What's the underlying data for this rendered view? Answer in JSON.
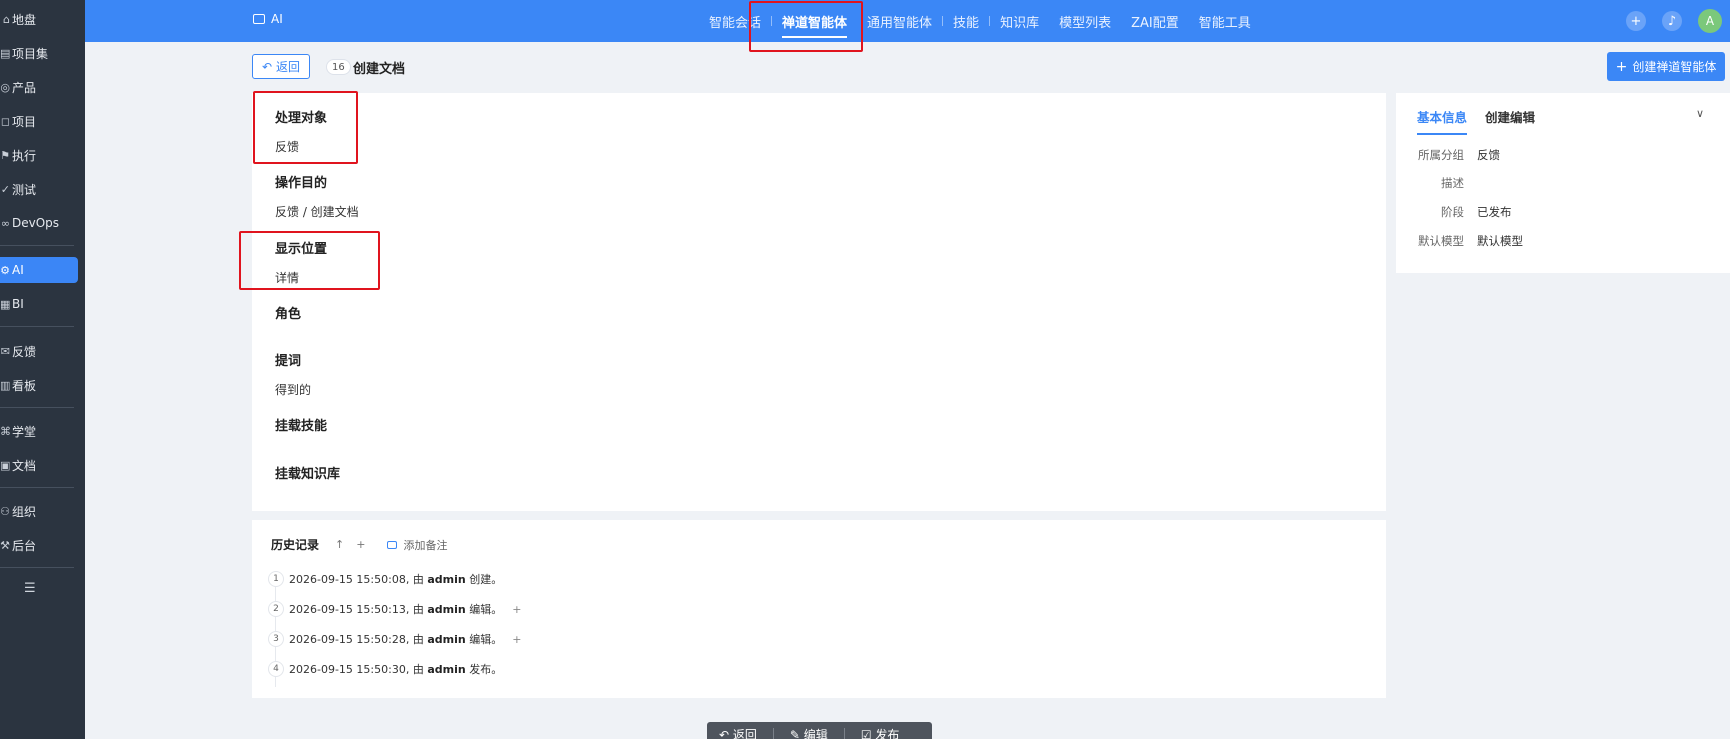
{
  "sidebar": {
    "items": [
      {
        "label": "地盘",
        "icon": "home-icon"
      },
      {
        "label": "项目集",
        "icon": "program-icon"
      },
      {
        "label": "产品",
        "icon": "product-icon"
      },
      {
        "label": "项目",
        "icon": "project-icon"
      },
      {
        "label": "执行",
        "icon": "execution-icon"
      },
      {
        "label": "测试",
        "icon": "test-icon"
      },
      {
        "label": "DevOps",
        "icon": "devops-icon"
      },
      {
        "label": "AI",
        "icon": "ai-icon"
      },
      {
        "label": "BI",
        "icon": "bi-icon"
      },
      {
        "label": "反馈",
        "icon": "feedback-icon"
      },
      {
        "label": "看板",
        "icon": "kanban-icon"
      },
      {
        "label": "学堂",
        "icon": "school-icon"
      },
      {
        "label": "文档",
        "icon": "doc-icon"
      },
      {
        "label": "组织",
        "icon": "org-icon"
      },
      {
        "label": "后台",
        "icon": "admin-icon"
      }
    ],
    "active": "AI"
  },
  "topbar": {
    "app_label": "AI",
    "nav": [
      "智能会话",
      "禅道智能体",
      "通用智能体",
      "技能",
      "知识库",
      "模型列表",
      "ZAI配置",
      "智能工具"
    ],
    "active_nav": "禅道智能体",
    "avatar_letter": "A"
  },
  "subheader": {
    "back_label": "返回",
    "id": "16",
    "title": "创建文档",
    "create_label": "创建禅道智能体"
  },
  "detail": {
    "target_label": "处理对象",
    "target_value": "反馈",
    "purpose_label": "操作目的",
    "purpose_value": "反馈 / 创建文档",
    "position_label": "显示位置",
    "position_value": "详情",
    "role_label": "角色",
    "prompt_label": "提词",
    "prompt_value": "得到的",
    "skills_label": "挂载技能",
    "kb_label": "挂载知识库"
  },
  "history": {
    "title": "历史记录",
    "sort_icon": "↑",
    "expand_icon": "+",
    "add_note_label": "添加备注",
    "entries": [
      {
        "num": "1",
        "time": "2026-09-15 15:50:08, 由 ",
        "user": "admin",
        "action": " 创建。"
      },
      {
        "num": "2",
        "time": "2026-09-15 15:50:13, 由 ",
        "user": "admin",
        "action": " 编辑。"
      },
      {
        "num": "3",
        "time": "2026-09-15 15:50:28, 由 ",
        "user": "admin",
        "action": " 编辑。"
      },
      {
        "num": "4",
        "time": "2026-09-15 15:50:30, 由 ",
        "user": "admin",
        "action": " 发布。"
      }
    ]
  },
  "side_panel": {
    "tabs": [
      "基本信息",
      "创建编辑"
    ],
    "active_tab": "基本信息",
    "rows": [
      {
        "key": "所属分组",
        "value": "反馈"
      },
      {
        "key": "描述",
        "value": ""
      },
      {
        "key": "阶段",
        "value": "已发布"
      },
      {
        "key": "默认模型",
        "value": "默认模型"
      }
    ]
  },
  "bottom_bar": {
    "back_label": "返回",
    "edit_label": "编辑",
    "publish_label": "发布"
  },
  "colors": {
    "primary": "#3b87f6",
    "sidebar_bg": "#2b3440",
    "highlight": "#e0141e"
  }
}
